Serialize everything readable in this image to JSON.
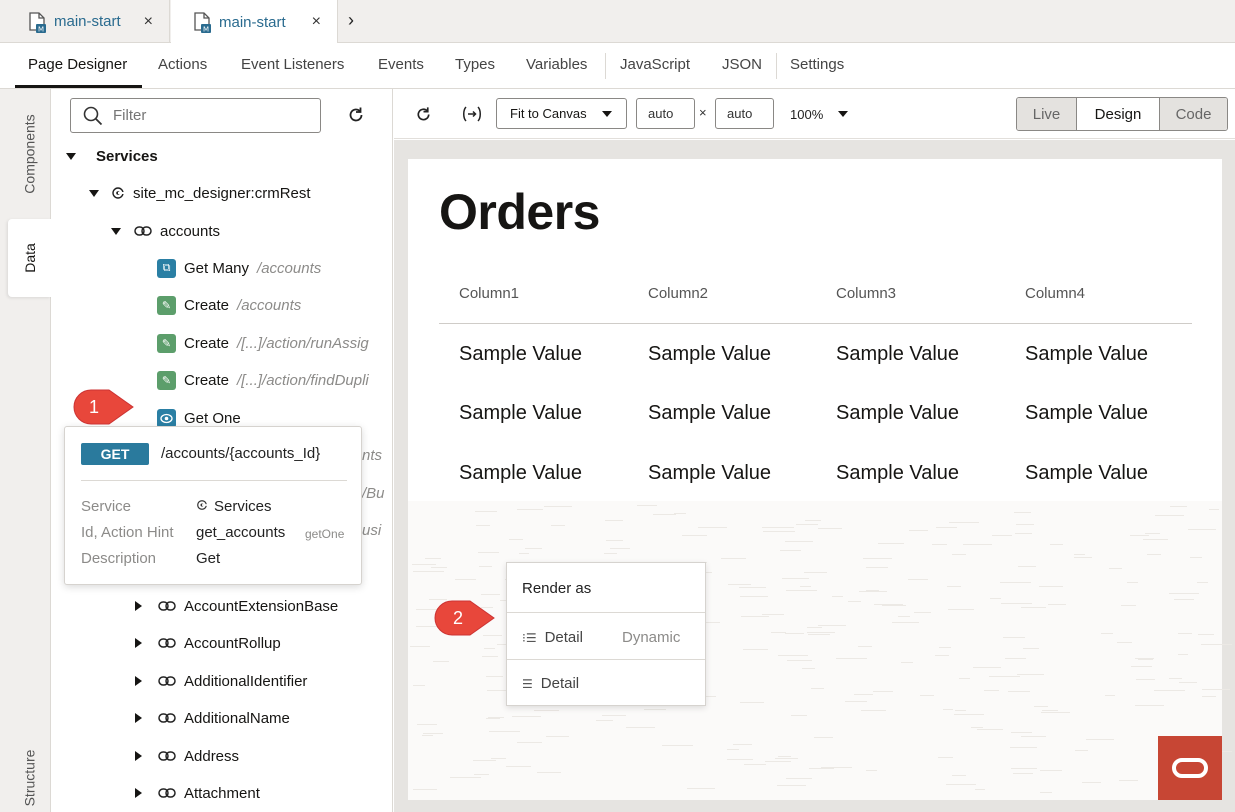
{
  "tabs": [
    {
      "label": "main-start",
      "close": "×"
    },
    {
      "label": "main-start",
      "close": "×"
    }
  ],
  "tab_next": "›",
  "subnav": {
    "items": [
      "Page Designer",
      "Actions",
      "Event Listeners",
      "Events",
      "Types",
      "Variables",
      "JavaScript",
      "JSON",
      "Settings"
    ]
  },
  "side_tabs": {
    "components": "Components",
    "data": "Data",
    "structure": "Structure"
  },
  "panel": {
    "filter_placeholder": "Filter",
    "tree": {
      "root": "Services",
      "service": "site_mc_designer:crmRest",
      "endpoint": "accounts",
      "ops": [
        {
          "label": "Get Many",
          "path": "/accounts"
        },
        {
          "label": "Create",
          "path": "/accounts"
        },
        {
          "label": "Create",
          "path": "/[...]/action/runAssig"
        },
        {
          "label": "Create",
          "path": "/[...]/action/findDupli"
        },
        {
          "label": "Get One",
          "path": ""
        }
      ],
      "hidden_fragments": [
        "nts",
        "/Bu",
        "usi"
      ],
      "children": [
        "AccountExtensionBase",
        "AccountRollup",
        "AdditionalIdentifier",
        "AdditionalName",
        "Address",
        "Attachment"
      ]
    }
  },
  "popup": {
    "method": "GET",
    "endpoint": "/accounts/{accounts_Id}",
    "service_label": "Service",
    "service_value": "Services",
    "id_label": "Id, Action Hint",
    "id_value": "get_accounts",
    "hint": "getOne",
    "desc_label": "Description",
    "desc_value": "Get"
  },
  "toolbar": {
    "fit": "Fit to Canvas",
    "width": "auto",
    "times": "×",
    "height": "auto",
    "zoom": "100%",
    "modes": [
      "Live",
      "Design",
      "Code"
    ]
  },
  "canvas": {
    "title": "Orders",
    "columns": [
      "Column1",
      "Column2",
      "Column3",
      "Column4"
    ],
    "rows": [
      [
        "Sample Value",
        "Sample Value",
        "Sample Value",
        "Sample Value"
      ],
      [
        "Sample Value",
        "Sample Value",
        "Sample Value",
        "Sample Value"
      ],
      [
        "Sample Value",
        "Sample Value",
        "Sample Value",
        "Sample Value"
      ]
    ]
  },
  "render_menu": {
    "title": "Render as",
    "options": [
      {
        "label": "Detail",
        "tag": "Dynamic"
      },
      {
        "label": "Detail",
        "tag": ""
      }
    ]
  },
  "callouts": [
    "1",
    "2"
  ],
  "colors": {
    "accent": "#2a7a9d",
    "callout": "#e8473b",
    "oracle": "#c74634",
    "create_green": "#5c9e6b"
  }
}
